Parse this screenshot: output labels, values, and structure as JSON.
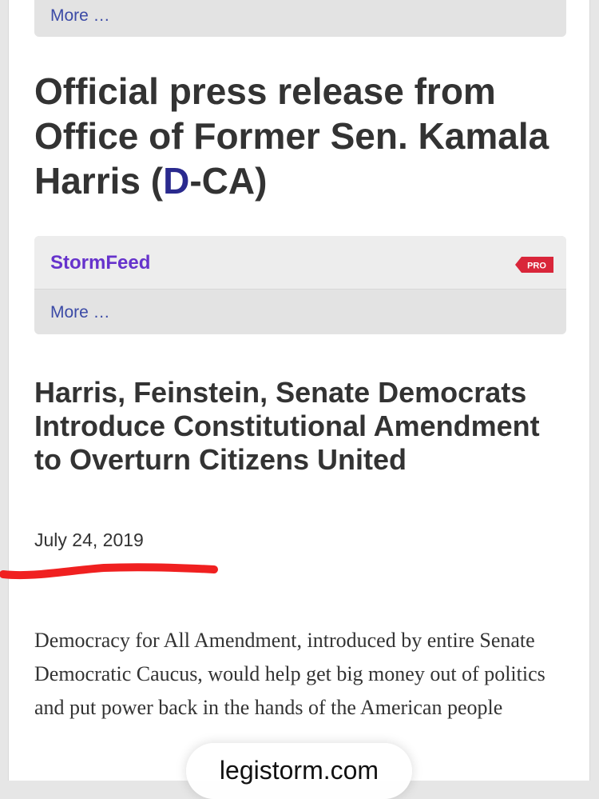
{
  "top_panel": {
    "more_label": "More …"
  },
  "press_heading": {
    "prefix": "Official press release from Office of Former Sen. Kamala Harris (",
    "party": "D",
    "suffix": "-CA)"
  },
  "feed_panel": {
    "title": "StormFeed",
    "badge": "PRO",
    "more_label": "More …"
  },
  "article": {
    "title": "Harris, Feinstein, Senate Democrats Introduce Constitutional Amendment to Overturn Citizens United",
    "date": "July 24, 2019",
    "summary": "Democracy for All Amendment, introduced by entire Senate Democratic Caucus, would help get big money out of politics and put power back in the hands of the American people"
  },
  "browser": {
    "url": "legistorm.com"
  },
  "colors": {
    "feed_title": "#6633cc",
    "party": "#2a2a8e",
    "link": "#3b4aa6",
    "badge": "#d9263a",
    "annotation": "#f02020"
  }
}
